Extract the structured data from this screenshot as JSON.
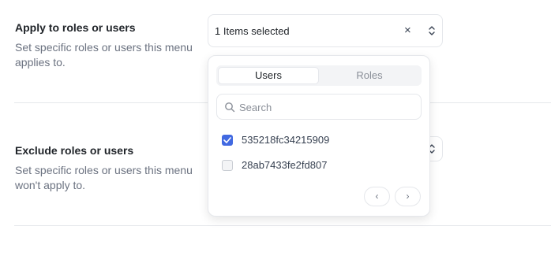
{
  "apply_section": {
    "title": "Apply to roles or users",
    "description": "Set specific roles or users this menu applies to.",
    "select_value": "1 Items selected",
    "clear_symbol": "×"
  },
  "exclude_section": {
    "title": "Exclude roles or users",
    "description": "Set specific roles or users this menu won't apply to."
  },
  "dropdown": {
    "tabs": [
      {
        "label": "Users",
        "active": true
      },
      {
        "label": "Roles",
        "active": false
      }
    ],
    "search_placeholder": "Search",
    "search_value": "",
    "options": [
      {
        "label": "535218fc34215909",
        "checked": true
      },
      {
        "label": "28ab7433fe2fd807",
        "checked": false
      }
    ],
    "pager": {
      "prev": "‹",
      "next": "›"
    }
  },
  "icons": {
    "search": "search-icon",
    "clear": "close-icon",
    "select_arrows": "chevron-up-down-icon",
    "check": "check-icon"
  },
  "colors": {
    "accent": "#4169e1",
    "muted_text": "#6b7280",
    "border": "#e5e7eb"
  }
}
